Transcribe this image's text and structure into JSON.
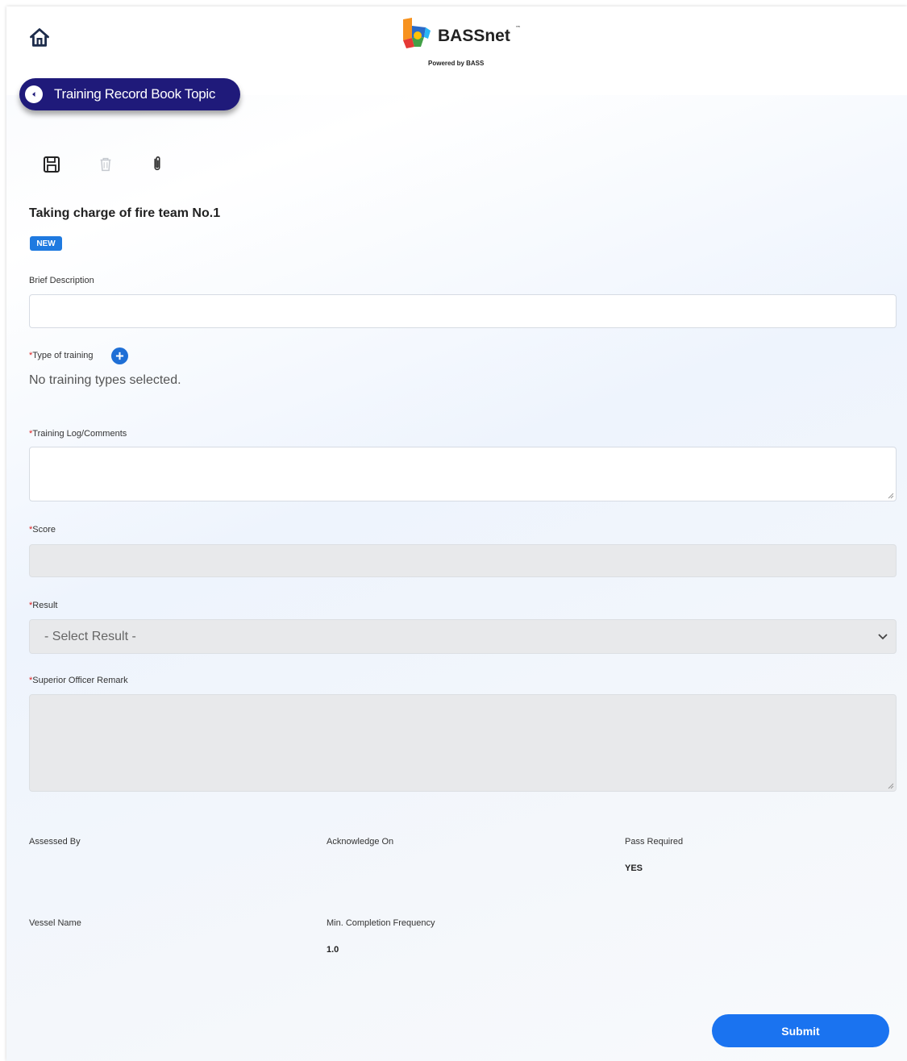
{
  "header": {
    "brand_name": "BASSnet",
    "brand_trademark": "™",
    "brand_tagline": "Powered by BASS",
    "home_icon": "home-icon"
  },
  "nav": {
    "back_label": "Training Record Book Topic",
    "back_icon": "chevron-left-icon"
  },
  "toolbar": {
    "save_icon": "save-icon",
    "delete_icon": "trash-icon",
    "attach_icon": "paperclip-icon"
  },
  "record": {
    "title": "Taking charge of fire team No.1",
    "status_badge": "NEW"
  },
  "form": {
    "brief_description": {
      "label": "Brief Description",
      "value": ""
    },
    "type_of_training": {
      "required_mark": "*",
      "label": "Type of training",
      "add_icon": "plus-icon",
      "empty_text": "No training types selected."
    },
    "training_log": {
      "required_mark": "*",
      "label": "Training Log/Comments",
      "value": ""
    },
    "score": {
      "required_mark": "*",
      "label": "Score",
      "value": ""
    },
    "result": {
      "required_mark": "*",
      "label": "Result",
      "selected": "- Select Result -"
    },
    "superior_remark": {
      "required_mark": "*",
      "label": "Superior Officer Remark",
      "value": ""
    }
  },
  "meta": {
    "assessed_by": {
      "label": "Assessed By",
      "value": ""
    },
    "acknowledge_on": {
      "label": "Acknowledge On",
      "value": ""
    },
    "pass_required": {
      "label": "Pass Required",
      "value": "YES"
    },
    "vessel_name": {
      "label": "Vessel Name",
      "value": ""
    },
    "min_completion_frequency": {
      "label": "Min. Completion Frequency",
      "value": "1.0"
    }
  },
  "actions": {
    "submit_label": "Submit"
  },
  "colors": {
    "nav_pill": "#1f1a7a",
    "accent": "#1a73f0",
    "badge": "#1f7ae0",
    "disabled_field": "#e8e9eb"
  }
}
